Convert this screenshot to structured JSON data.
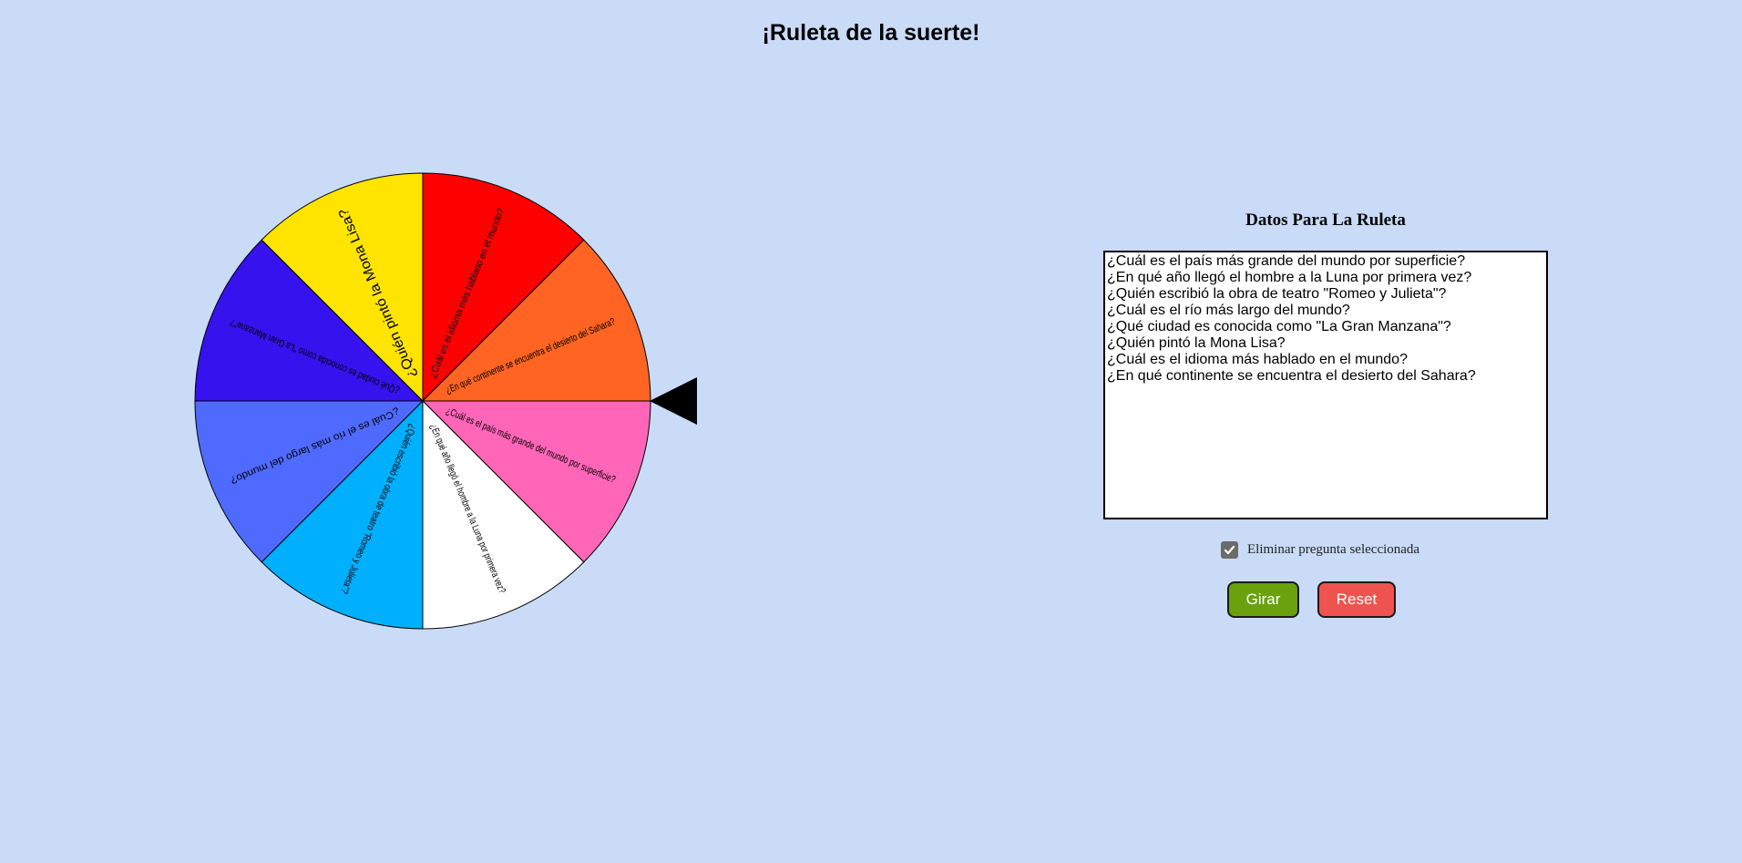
{
  "page_title": "¡Ruleta de la suerte!",
  "wheel": {
    "segments": [
      {
        "label": "¿Cuál es el país más grande del mundo por superficie?",
        "color": "#ff66b8"
      },
      {
        "label": "¿En qué año llegó el hombre a la Luna por primera vez?",
        "color": "#ffffff"
      },
      {
        "label": "¿Quién escribió la obra de teatro \"Romeo y Julieta\"?",
        "color": "#00b0ff"
      },
      {
        "label": "¿Cuál es el río más largo del mundo?",
        "color": "#4f6bff"
      },
      {
        "label": "¿Qué ciudad es conocida como \"La Gran Manzana\"?",
        "color": "#3512ee"
      },
      {
        "label": "¿Quién pintó la Mona Lisa?",
        "color": "#ffe400"
      },
      {
        "label": "¿Cuál es el idioma más hablado en el mundo?",
        "color": "#ff0000"
      },
      {
        "label": "¿En qué continente se encuentra el desierto del Sahara?",
        "color": "#ff6422"
      }
    ]
  },
  "panel": {
    "title": "Datos Para La Ruleta",
    "questions_text": "¿Cuál es el país más grande del mundo por superficie?\n¿En qué año llegó el hombre a la Luna por primera vez?\n¿Quién escribió la obra de teatro \"Romeo y Julieta\"?\n¿Cuál es el río más largo del mundo?\n¿Qué ciudad es conocida como \"La Gran Manzana\"?\n¿Quién pintó la Mona Lisa?\n¿Cuál es el idioma más hablado en el mundo?\n¿En qué continente se encuentra el desierto del Sahara?",
    "checkbox_label": "Eliminar pregunta seleccionada",
    "checkbox_checked": true,
    "spin_button": "Girar",
    "reset_button": "Reset",
    "spin_color": "#6aa10c",
    "reset_color": "#ef5350"
  },
  "background_color": "#c9dbf7"
}
